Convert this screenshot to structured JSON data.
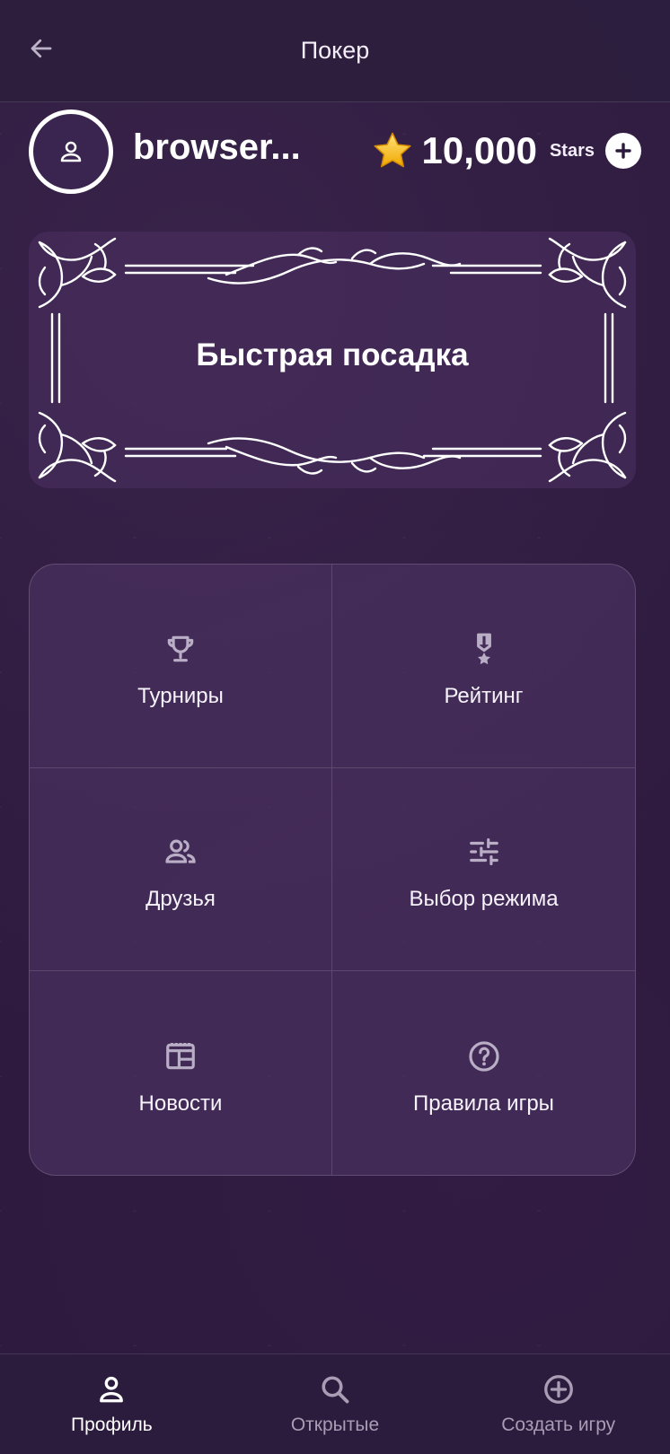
{
  "header": {
    "title": "Покер",
    "back_icon": "arrow-left-icon"
  },
  "profile": {
    "username": "browser...",
    "avatar_icon": "person-icon",
    "balance_value": "10,000",
    "balance_unit": "Stars",
    "star_icon": "star-icon",
    "add_icon": "plus-circle-icon"
  },
  "quick_seat": {
    "label": "Быстрая посадка"
  },
  "menu": {
    "items": [
      {
        "label": "Турниры",
        "icon": "trophy-icon"
      },
      {
        "label": "Рейтинг",
        "icon": "medal-icon"
      },
      {
        "label": "Друзья",
        "icon": "people-icon"
      },
      {
        "label": "Выбор режима",
        "icon": "sliders-icon"
      },
      {
        "label": "Новости",
        "icon": "newspaper-icon"
      },
      {
        "label": "Правила игры",
        "icon": "help-circle-icon"
      }
    ]
  },
  "nav": {
    "items": [
      {
        "label": "Профиль",
        "icon": "person-icon",
        "active": true
      },
      {
        "label": "Открытые",
        "icon": "search-icon",
        "active": false
      },
      {
        "label": "Создать игру",
        "icon": "add-circle-icon",
        "active": false
      }
    ]
  },
  "colors": {
    "background": "#2c1a3c",
    "accent_text": "#ffffff",
    "inactive_text": "#a99db6",
    "star": "#f5c518"
  }
}
